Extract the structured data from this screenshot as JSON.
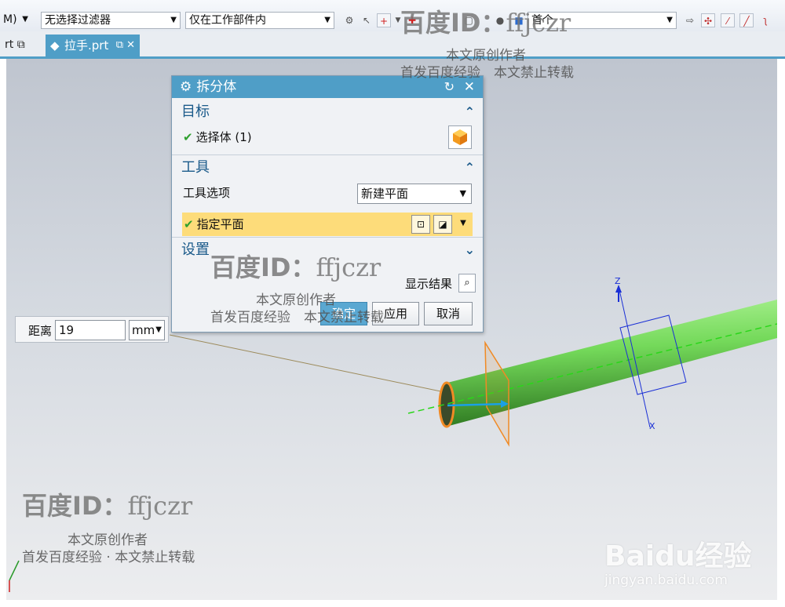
{
  "toolbar": {
    "menu_label": "M)",
    "filter_value": "无选择过滤器",
    "scope_value": "仅在工作部件内",
    "view_value": "首个"
  },
  "tabs": {
    "prev_label": "rt",
    "active_label": "拉手.prt"
  },
  "dialog": {
    "title": "拆分体",
    "target": {
      "header": "目标",
      "select_body": "选择体 (1)"
    },
    "tool": {
      "header": "工具",
      "option_label": "工具选项",
      "option_value": "新建平面",
      "plane_label": "指定平面"
    },
    "settings": {
      "header": "设置"
    },
    "show_result": "显示结果",
    "buttons": {
      "ok": "确定",
      "apply": "应用",
      "cancel": "取消"
    }
  },
  "distance": {
    "label": "距离",
    "value": "19",
    "unit": "mm"
  },
  "axes": {
    "z": "Z",
    "x": "X"
  },
  "watermark": {
    "id_brand": "百度ID：",
    "id_name": "ffjczr",
    "line1": "本文原创作者",
    "line2": "首发百度经验",
    "line3": "本文禁止转载",
    "line2_joined": "首发百度经验 · 本文禁止转载",
    "baidu_logo": "Baidu经验",
    "baidu_site": "jingyan.baidu.com"
  },
  "colors": {
    "accent": "#4f9ec7",
    "highlight": "#fddc7a",
    "pipe": "#7fdc66",
    "plane_orange": "#f08a24",
    "csys_blue": "#1a2fd6"
  }
}
